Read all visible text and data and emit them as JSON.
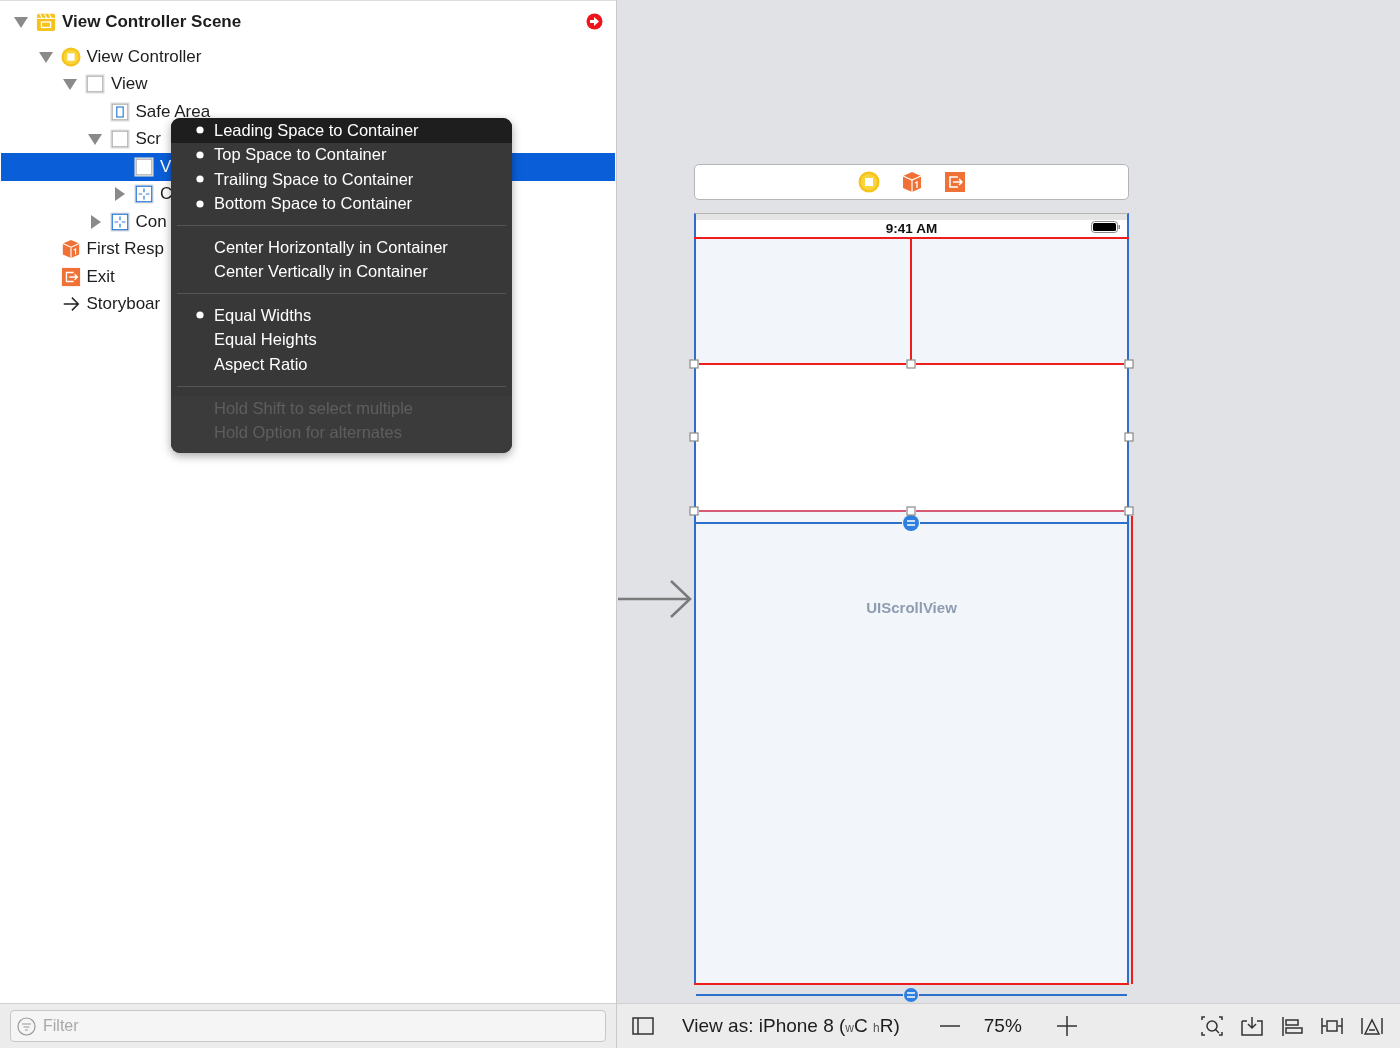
{
  "navigator": {
    "tree": [
      {
        "label": "View Controller Scene",
        "kind": "scene",
        "expanded": true,
        "selected": false,
        "children": [
          {
            "label": "View Controller",
            "kind": "controller",
            "expanded": true,
            "selected": false,
            "children": [
              {
                "label": "View",
                "kind": "view",
                "expanded": true,
                "selected": false,
                "children": [
                  {
                    "label": "Safe Area",
                    "kind": "safe-area",
                    "selected": false
                  },
                  {
                    "label": "Scr",
                    "kind": "view",
                    "expanded": true,
                    "selected": false,
                    "children": [
                      {
                        "label": "V",
                        "kind": "view",
                        "selected": true
                      },
                      {
                        "label": "C",
                        "kind": "constraints",
                        "expanded": false,
                        "selected": false
                      }
                    ]
                  },
                  {
                    "label": "Con",
                    "kind": "constraints",
                    "expanded": false,
                    "selected": false
                  }
                ]
              }
            ]
          },
          {
            "label": "First Resp",
            "kind": "responder",
            "selected": false
          },
          {
            "label": "Exit",
            "kind": "exit",
            "selected": false
          },
          {
            "label": "Storyboar",
            "kind": "entry",
            "selected": false
          }
        ]
      }
    ]
  },
  "constraint_menu": {
    "groups": [
      {
        "items": [
          {
            "label": "Leading Space to Container",
            "bullet": true,
            "selected": true
          },
          {
            "label": "Top Space to Container",
            "bullet": true,
            "selected": false
          },
          {
            "label": "Trailing Space to Container",
            "bullet": true,
            "selected": false
          },
          {
            "label": "Bottom Space to Container",
            "bullet": true,
            "selected": false
          }
        ]
      },
      {
        "items": [
          {
            "label": "Center Horizontally in Container",
            "bullet": false,
            "selected": false
          },
          {
            "label": "Center Vertically in Container",
            "bullet": false,
            "selected": false
          }
        ]
      },
      {
        "items": [
          {
            "label": "Equal Widths",
            "bullet": true,
            "selected": false
          },
          {
            "label": "Equal Heights",
            "bullet": false,
            "selected": false
          },
          {
            "label": "Aspect Ratio",
            "bullet": false,
            "selected": false
          }
        ]
      }
    ],
    "hints": [
      "Hold Shift to select multiple",
      "Hold Option for alternates"
    ]
  },
  "canvas": {
    "status_bar": {
      "time": "9:41 AM"
    },
    "scroll_view_label": "UIScrollView"
  },
  "filter": {
    "placeholder": "Filter"
  },
  "canvas_toolbar": {
    "view_as": "View as: iPhone 8 ($_{w}$C $_{h}$R)",
    "zoom": "75%"
  }
}
